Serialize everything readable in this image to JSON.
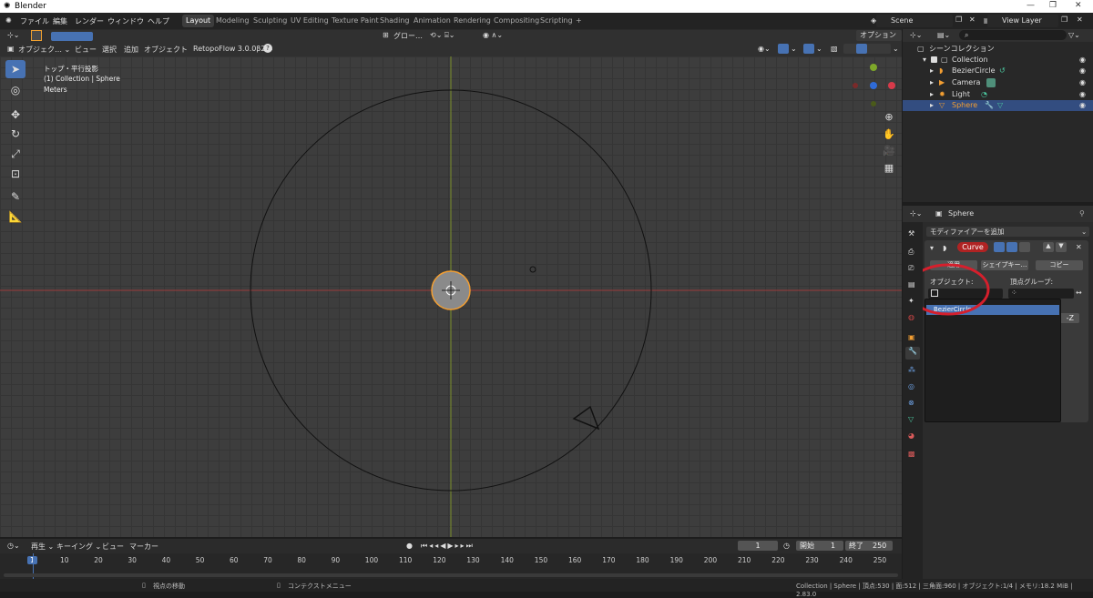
{
  "window": {
    "title": "Blender"
  },
  "menu": [
    "ファイル",
    "編集",
    "レンダー",
    "ウィンドウ",
    "ヘルプ"
  ],
  "workspaces": [
    "Layout",
    "Modeling",
    "Sculpting",
    "UV Editing",
    "Texture Paint",
    "Shading",
    "Animation",
    "Rendering",
    "Compositing",
    "Scripting",
    "+"
  ],
  "scene": {
    "label": "Scene",
    "view_layer": "View Layer"
  },
  "viewport_header": {
    "mode": "オブジェク…",
    "menus": [
      "ビュー",
      "選択",
      "追加",
      "オブジェクト"
    ],
    "addon": "RetopoFlow 3.0.0β2",
    "orientation": "グロー…",
    "options": "オプション"
  },
  "viewport_overlay": {
    "view_name": "トップ・平行投影",
    "context": "(1) Collection | Sphere",
    "units": "Meters"
  },
  "outliner": {
    "title": "シーンコレクション",
    "items": [
      {
        "label": "Collection"
      },
      {
        "label": "BezierCircle"
      },
      {
        "label": "Camera"
      },
      {
        "label": "Light"
      },
      {
        "label": "Sphere"
      }
    ]
  },
  "properties": {
    "object_name": "Sphere",
    "add_modifier": "モディファイアーを追加",
    "modifier_name": "Curve",
    "apply": "適用",
    "shape_key": "シェイプキー…",
    "copy": "コピー",
    "object_label": "オブジェクト:",
    "vertex_group_label": "頂点グループ:",
    "axis_partial": "-Z",
    "dropdown_option": "BezierCircle"
  },
  "timeline": {
    "menus": [
      "再生",
      "キーイング",
      "ビュー",
      "マーカー"
    ],
    "current_frame": "1",
    "start_label": "開始",
    "start": "1",
    "end_label": "終了",
    "end": "250",
    "ticks": [
      "1",
      "10",
      "20",
      "30",
      "40",
      "50",
      "60",
      "70",
      "80",
      "90",
      "100",
      "110",
      "120",
      "130",
      "140",
      "150",
      "160",
      "170",
      "180",
      "190",
      "200",
      "210",
      "220",
      "230",
      "240",
      "250"
    ]
  },
  "statusbar": {
    "left": "視点の移動",
    "middle": "コンテクストメニュー",
    "right": "Collection | Sphere | 頂点:530 | 面:512 | 三角面:960 | オブジェクト:1/4 | メモリ:18.2 MiB | 2.83.0"
  },
  "colors": {
    "accent": "#4772b3",
    "selection_orange": "#f29e32",
    "curve_red": "#b02323",
    "annotation_red": "#d61f2c"
  }
}
